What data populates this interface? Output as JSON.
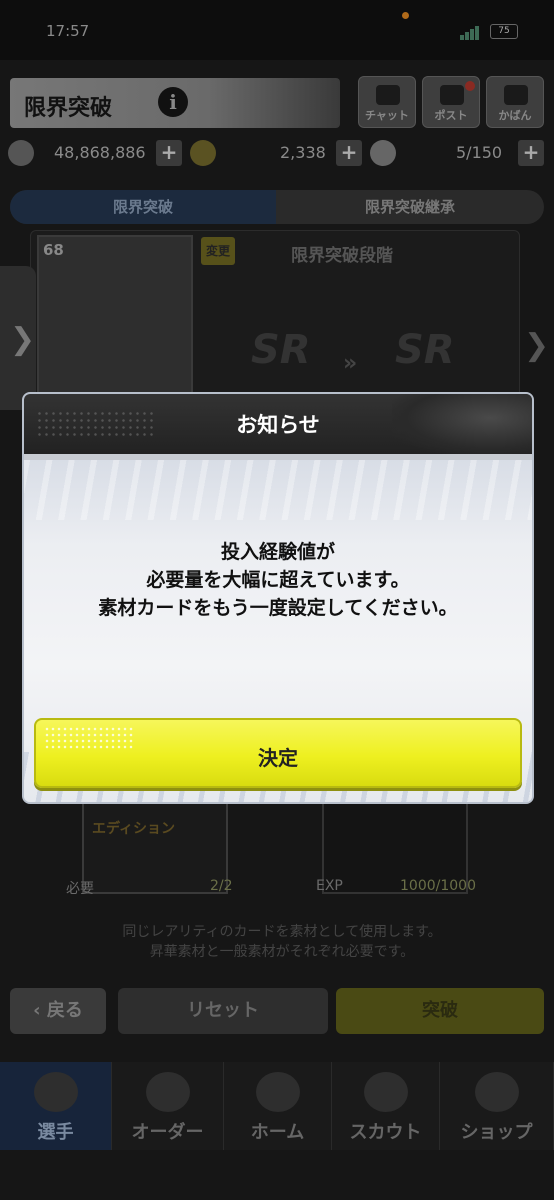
{
  "status_bar": {
    "time": "17:57",
    "battery": "75"
  },
  "header": {
    "title": "限界突破",
    "buttons": [
      {
        "label": "チャット",
        "icon": "chat-icon"
      },
      {
        "label": "ポスト",
        "icon": "mail-icon"
      },
      {
        "label": "かばん",
        "icon": "bag-icon"
      }
    ]
  },
  "resources": {
    "coins": "48,868,886",
    "stars": "2,338",
    "balls": "5/150"
  },
  "tabs": [
    {
      "label": "限界突破",
      "active": true
    },
    {
      "label": "限界突破継承",
      "active": false
    }
  ],
  "card": {
    "level": "68",
    "change_label": "変更",
    "stage_title": "限界突破段階",
    "from_rank": "SR",
    "to_rank": "SR"
  },
  "materials": {
    "edition_label": "エディション",
    "required_label": "必要",
    "required_value": "2/2",
    "exp_label": "EXP",
    "exp_value": "1000/1000",
    "note_line1": "同じレアリティのカードを素材として使用します。",
    "note_line2": "昇華素材と一般素材がそれぞれ必要です。"
  },
  "bottom_buttons": {
    "back": "戻る",
    "reset": "リセット",
    "break": "突破"
  },
  "nav": [
    {
      "label": "選手",
      "active": true
    },
    {
      "label": "オーダー",
      "active": false
    },
    {
      "label": "ホーム",
      "active": false
    },
    {
      "label": "スカウト",
      "active": false
    },
    {
      "label": "ショップ",
      "active": false
    }
  ],
  "modal": {
    "title": "お知らせ",
    "message_line1": "投入経験値が",
    "message_line2": "必要量を大幅に超えています。",
    "message_line3": "素材カードをもう一度設定してください。",
    "confirm_label": "決定"
  }
}
